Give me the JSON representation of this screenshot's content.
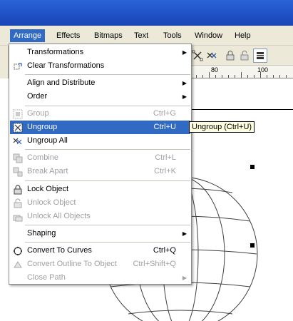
{
  "menubar": {
    "items": [
      {
        "label": "Arrange"
      },
      {
        "label": "Effects"
      },
      {
        "label": "Bitmaps"
      },
      {
        "label": "Text"
      },
      {
        "label": "Tools"
      },
      {
        "label": "Window"
      },
      {
        "label": "Help"
      }
    ]
  },
  "toolbar": {
    "icons": [
      "ungroup-icon",
      "ungroup-all-icon",
      "lock-icon",
      "unlock-icon",
      "options-icon"
    ]
  },
  "ruler": {
    "labels": [
      "80",
      "100"
    ]
  },
  "menu": {
    "items": [
      {
        "label": "Transformations",
        "submenu": true
      },
      {
        "label": "Clear Transformations"
      },
      {
        "label": "Align and Distribute",
        "submenu": true
      },
      {
        "label": "Order",
        "submenu": true
      },
      {
        "label": "Group",
        "shortcut": "Ctrl+G",
        "disabled": true
      },
      {
        "label": "Ungroup",
        "shortcut": "Ctrl+U",
        "highlighted": true
      },
      {
        "label": "Ungroup All"
      },
      {
        "label": "Combine",
        "shortcut": "Ctrl+L",
        "disabled": true
      },
      {
        "label": "Break  Apart",
        "shortcut": "Ctrl+K",
        "disabled": true
      },
      {
        "label": "Lock Object"
      },
      {
        "label": "Unlock Object",
        "disabled": true
      },
      {
        "label": "Unlock All Objects",
        "disabled": true
      },
      {
        "label": "Shaping",
        "submenu": true
      },
      {
        "label": "Convert To Curves",
        "shortcut": "Ctrl+Q"
      },
      {
        "label": "Convert Outline To Object",
        "shortcut": "Ctrl+Shift+Q",
        "disabled": true
      },
      {
        "label": "Close Path",
        "submenu": true,
        "disabled": true
      }
    ]
  },
  "tooltip": {
    "text": "Ungroup (Ctrl+U)"
  },
  "colors": {
    "highlight": "#316ac5",
    "menubar": "#ece9d8",
    "titlebar": "#1e4fc4",
    "tooltip": "#ffffe1"
  }
}
